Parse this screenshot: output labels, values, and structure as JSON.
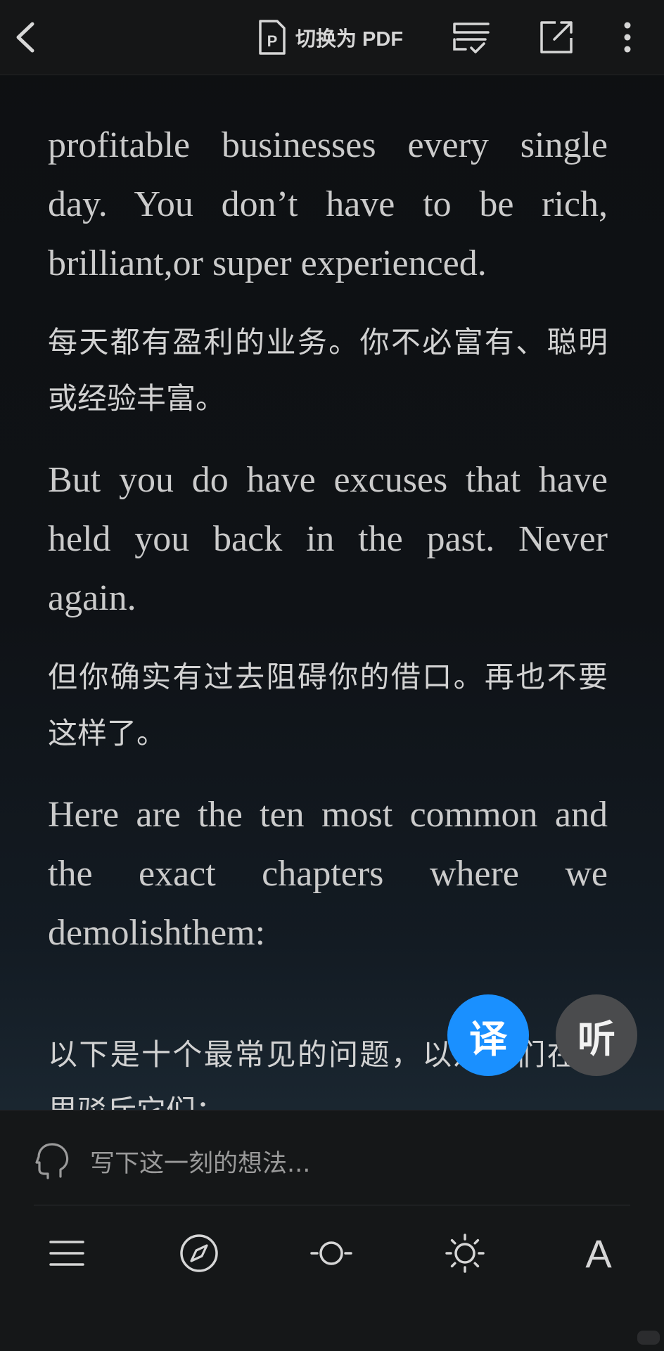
{
  "topbar": {
    "pdf_label": "切换为 PDF"
  },
  "content": {
    "paragraphs": [
      {
        "lang": "en",
        "text": "profitable businesses every single day. You don’t have to be rich, brilliant,or super experienced."
      },
      {
        "lang": "zh",
        "text": "每天都有盈利的业务。你不必富有、聪明或经验丰富。"
      },
      {
        "lang": "en",
        "text": "But you do have excuses that have held you back in the past. Never again."
      },
      {
        "lang": "zh",
        "text": "但你确实有过去阻碍你的借口。再也不要这样了。"
      },
      {
        "lang": "en",
        "text": "Here are the ten most common and the exact chapters where we demolishthem:"
      },
      {
        "lang": "zh",
        "text": "以下是十个最常见的问题，以及我们在哪里驳斥它们："
      }
    ]
  },
  "fabs": {
    "translate": "译",
    "listen": "听"
  },
  "bottom": {
    "thought_placeholder": "写下这一刻的想法...",
    "font_label": "A"
  },
  "colors": {
    "translate_button": "#1a90ff",
    "listen_button": "#4a4b4d",
    "background": "#0d0f12"
  }
}
